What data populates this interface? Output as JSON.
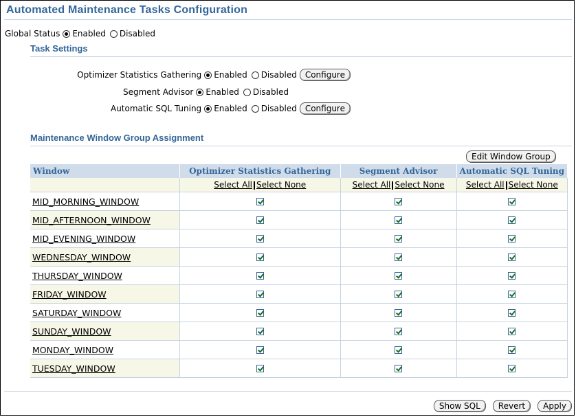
{
  "page": {
    "title": "Automated Maintenance Tasks Configuration"
  },
  "global_status": {
    "label": "Global Status",
    "options": [
      "Enabled",
      "Disabled"
    ],
    "selected": "Enabled"
  },
  "task_settings": {
    "title": "Task Settings",
    "tasks": [
      {
        "name": "Optimizer Statistics Gathering",
        "enabled_label": "Enabled",
        "disabled_label": "Disabled",
        "selected": "Enabled",
        "configure_label": "Configure"
      },
      {
        "name": "Segment Advisor",
        "enabled_label": "Enabled",
        "disabled_label": "Disabled",
        "selected": "Enabled",
        "configure_label": ""
      },
      {
        "name": "Automatic SQL Tuning",
        "enabled_label": "Enabled",
        "disabled_label": "Disabled",
        "selected": "Enabled",
        "configure_label": "Configure"
      }
    ]
  },
  "window_group": {
    "title": "Maintenance Window Group Assignment",
    "edit_button": "Edit Window Group",
    "columns": [
      "Window",
      "Optimizer Statistics Gathering",
      "Segment Advisor",
      "Automatic SQL Tuning"
    ],
    "select_all": "Select All",
    "select_none": "Select None",
    "rows": [
      {
        "window": "MID_MORNING_WINDOW",
        "checks": [
          true,
          true,
          true
        ]
      },
      {
        "window": "MID_AFTERNOON_WINDOW",
        "checks": [
          true,
          true,
          true
        ]
      },
      {
        "window": "MID_EVENING_WINDOW",
        "checks": [
          true,
          true,
          true
        ]
      },
      {
        "window": "WEDNESDAY_WINDOW",
        "checks": [
          true,
          true,
          true
        ]
      },
      {
        "window": "THURSDAY_WINDOW",
        "checks": [
          true,
          true,
          true
        ]
      },
      {
        "window": "FRIDAY_WINDOW",
        "checks": [
          true,
          true,
          true
        ]
      },
      {
        "window": "SATURDAY_WINDOW",
        "checks": [
          true,
          true,
          true
        ]
      },
      {
        "window": "SUNDAY_WINDOW",
        "checks": [
          true,
          true,
          true
        ]
      },
      {
        "window": "MONDAY_WINDOW",
        "checks": [
          true,
          true,
          true
        ]
      },
      {
        "window": "TUESDAY_WINDOW",
        "checks": [
          true,
          true,
          true
        ]
      }
    ]
  },
  "footer": {
    "show_sql": "Show SQL",
    "revert": "Revert",
    "apply": "Apply"
  },
  "colors": {
    "accent": "#336699",
    "header_bg": "#d0dcea",
    "alt_row_bg": "#f7f7e7"
  }
}
